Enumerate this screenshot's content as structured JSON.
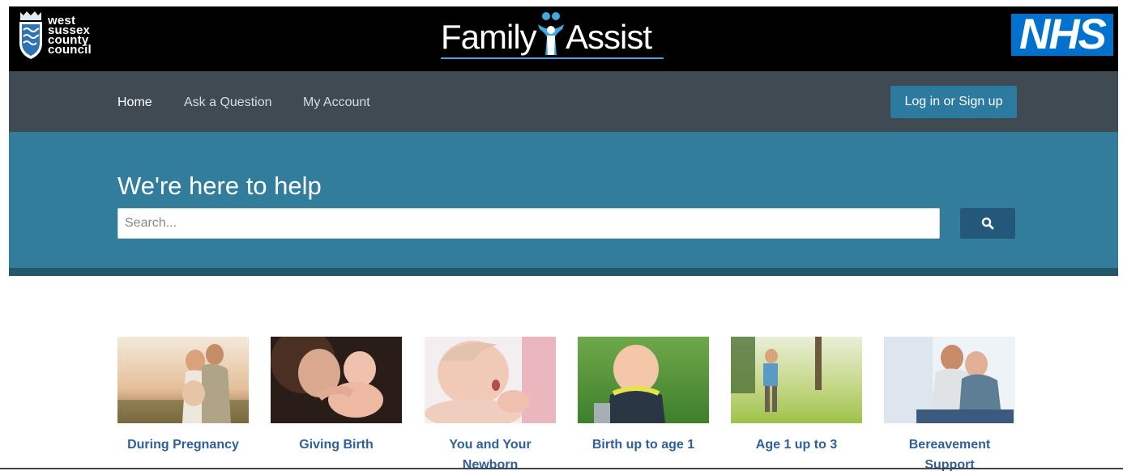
{
  "header": {
    "council_logo": [
      "west",
      "sussex",
      "county",
      "council"
    ],
    "brand_left": "Family",
    "brand_right": "Assist",
    "nhs_logo": "NHS"
  },
  "nav": {
    "items": [
      "Home",
      "Ask a Question",
      "My Account"
    ],
    "login_label": "Log in or Sign up"
  },
  "hero": {
    "title": "We're here to help",
    "search_placeholder": "Search...",
    "search_icon": "search-icon"
  },
  "categories": [
    {
      "label": "During Pregnancy",
      "image": "pregnant-couple-photo"
    },
    {
      "label": "Giving Birth",
      "image": "mother-newborn-photo"
    },
    {
      "label": "You and Your Newborn",
      "image": "newborn-baby-photo"
    },
    {
      "label": "Birth up to age 1",
      "image": "smiling-baby-grass-photo"
    },
    {
      "label": "Age 1 up to 3",
      "image": "toddler-walking-park-photo"
    },
    {
      "label": "Bereavement Support",
      "image": "consoling-couple-photo"
    }
  ],
  "colors": {
    "banner": "#000000",
    "nav": "#3f4a53",
    "hero": "#337d9c",
    "button": "#2d7aa0",
    "search_button": "#24587a",
    "link": "#2f5f9c",
    "nhs_blue": "#0072ce"
  }
}
